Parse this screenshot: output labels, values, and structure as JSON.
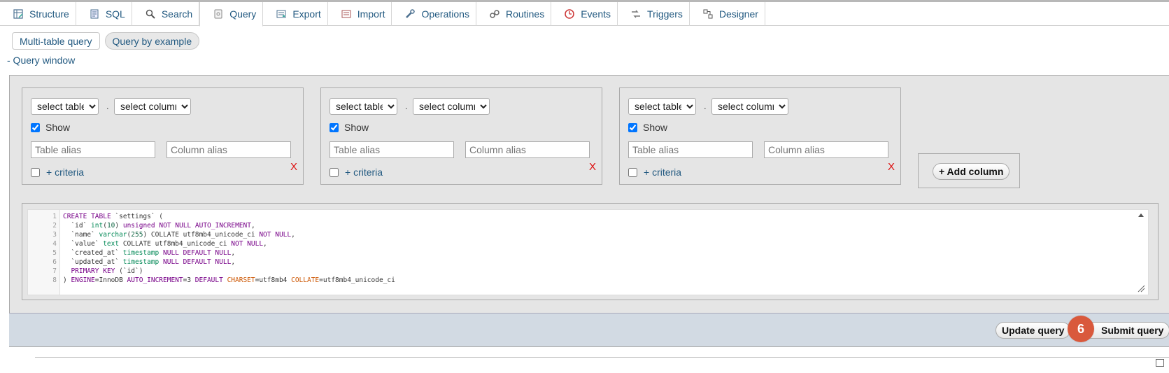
{
  "tabs": [
    {
      "label": "Structure",
      "icon": "structure-icon"
    },
    {
      "label": "SQL",
      "icon": "sql-icon"
    },
    {
      "label": "Search",
      "icon": "search-icon"
    },
    {
      "label": "Query",
      "icon": "query-icon",
      "active": true
    },
    {
      "label": "Export",
      "icon": "export-icon"
    },
    {
      "label": "Import",
      "icon": "import-icon"
    },
    {
      "label": "Operations",
      "icon": "operations-icon"
    },
    {
      "label": "Routines",
      "icon": "routines-icon"
    },
    {
      "label": "Events",
      "icon": "events-icon"
    },
    {
      "label": "Triggers",
      "icon": "triggers-icon"
    },
    {
      "label": "Designer",
      "icon": "designer-icon"
    }
  ],
  "subtabs": [
    {
      "label": "Multi-table query"
    },
    {
      "label": "Query by example",
      "active": true
    }
  ],
  "query_window_link": "- Query window",
  "columns": [
    {
      "table_select": "select table",
      "column_select": "select column",
      "show_label": "Show",
      "show_checked": true,
      "table_alias_placeholder": "Table alias",
      "column_alias_placeholder": "Column alias",
      "criteria_label": "+ criteria",
      "remove_label": "X"
    },
    {
      "table_select": "select table",
      "column_select": "select column",
      "show_label": "Show",
      "show_checked": true,
      "table_alias_placeholder": "Table alias",
      "column_alias_placeholder": "Column alias",
      "criteria_label": "+ criteria",
      "remove_label": "X"
    },
    {
      "table_select": "select table",
      "column_select": "select column",
      "show_label": "Show",
      "show_checked": true,
      "table_alias_placeholder": "Table alias",
      "column_alias_placeholder": "Column alias",
      "criteria_label": "+ criteria",
      "remove_label": "X"
    }
  ],
  "add_column_label": "+ Add column",
  "sql_lines": [
    "CREATE TABLE `settings` (",
    "  `id` int(10) unsigned NOT NULL AUTO_INCREMENT,",
    "  `name` varchar(255) COLLATE utf8mb4_unicode_ci NOT NULL,",
    "  `value` text COLLATE utf8mb4_unicode_ci NOT NULL,",
    "  `created_at` timestamp NULL DEFAULT NULL,",
    "  `updated_at` timestamp NULL DEFAULT NULL,",
    "  PRIMARY KEY (`id`)",
    ") ENGINE=InnoDB AUTO_INCREMENT=3 DEFAULT CHARSET=utf8mb4 COLLATE=utf8mb4_unicode_ci"
  ],
  "line_numbers": [
    "1",
    "2",
    "3",
    "4",
    "5",
    "6",
    "7",
    "8"
  ],
  "buttons": {
    "update": "Update query",
    "submit": "Submit query"
  },
  "step_badge": "6",
  "colors": {
    "accent_link": "#235a81",
    "badge": "#d9593c",
    "remove": "#dd1111"
  }
}
